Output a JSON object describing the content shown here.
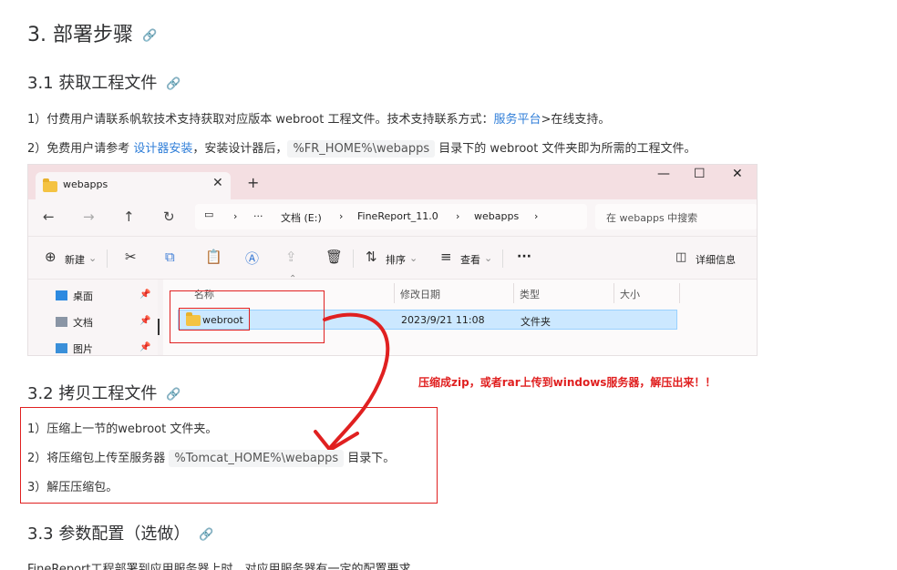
{
  "section": {
    "title": "3. 部署步骤",
    "s31_title": "3.1 获取工程文件",
    "s31_p1_pre": "1）付费用户请联系帆软技术支持获取对应版本 webroot 工程文件。技术支持联系方式：",
    "s31_p1_link": "服务平台",
    "s31_p1_post": ">在线支持。",
    "s31_p2_pre": "2）免费用户请参考 ",
    "s31_p2_link": "设计器安装",
    "s31_p2_mid": "，安装设计器后，",
    "s31_p2_code": "%FR_HOME%\\webapps",
    "s31_p2_post": " 目录下的 webroot 文件夹即为所需的工程文件。",
    "s32_title": "3.2 拷贝工程文件",
    "s32_p1": "1）压缩上一节的webroot 文件夹。",
    "s32_p2_pre": "2）将压缩包上传至服务器 ",
    "s32_p2_code": "%Tomcat_HOME%\\webapps",
    "s32_p2_post": " 目录下。",
    "s32_p3": "3）解压压缩包。",
    "s33_title": "3.3 参数配置（选做）",
    "s33_p1": "FineReport工程部署到应用服务器上时，对应用服务器有一定的配置要求"
  },
  "annotation": {
    "note": "压缩成zip，或者rar上传到windows服务器，解压出来！！",
    "color": "#e02020"
  },
  "explorer": {
    "tab_title": "webapps",
    "tab_close": "✕",
    "new_tab": "+",
    "win_min": "—",
    "win_max": "☐",
    "win_close": "✕",
    "nav_back": "←",
    "nav_forward": "→",
    "nav_up": "↑",
    "nav_refresh": "↻",
    "breadcrumb": [
      "文档 (E:)",
      "FineReport_11.0",
      "webapps"
    ],
    "more": "···",
    "search_placeholder": "在 webapps 中搜索",
    "toolbar": {
      "new": "新建",
      "sort": "排序",
      "view": "查看",
      "more": "···",
      "details": "详细信息"
    },
    "nav_items": [
      "桌面",
      "文档",
      "图片"
    ],
    "columns": [
      "名称",
      "修改日期",
      "类型",
      "大小"
    ],
    "rows": [
      {
        "name": "webroot",
        "modified": "2023/9/21 11:08",
        "type": "文件夹",
        "size": ""
      }
    ]
  }
}
